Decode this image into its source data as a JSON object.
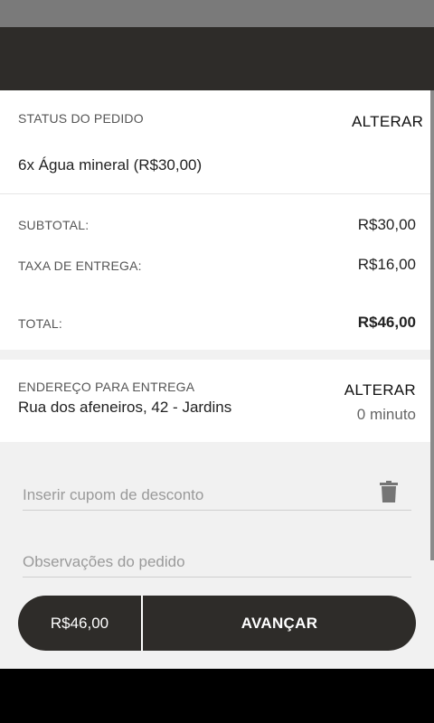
{
  "order": {
    "status_label": "STATUS DO PEDIDO",
    "change_label": "ALTERAR",
    "item": "6x Água mineral (R$30,00)"
  },
  "summary": {
    "subtotal_label": "SUBTOTAL:",
    "subtotal_value": "R$30,00",
    "fee_label": "TAXA DE ENTREGA:",
    "fee_value": "R$16,00",
    "total_label": "TOTAL:",
    "total_value": "R$46,00"
  },
  "address": {
    "label": "ENDEREÇO PARA ENTREGA",
    "value": "Rua dos afeneiros, 42 - Jardins",
    "change_label": "ALTERAR",
    "eta": "0 minuto"
  },
  "form": {
    "coupon_placeholder": "Inserir cupom de desconto",
    "notes_placeholder": "Observações do pedido"
  },
  "footer": {
    "price": "R$46,00",
    "advance_label": "AVANÇAR"
  },
  "colors": {
    "dark": "#2e2c29",
    "statusbar": "#7a7a7a",
    "background": "#f1f1f1"
  }
}
